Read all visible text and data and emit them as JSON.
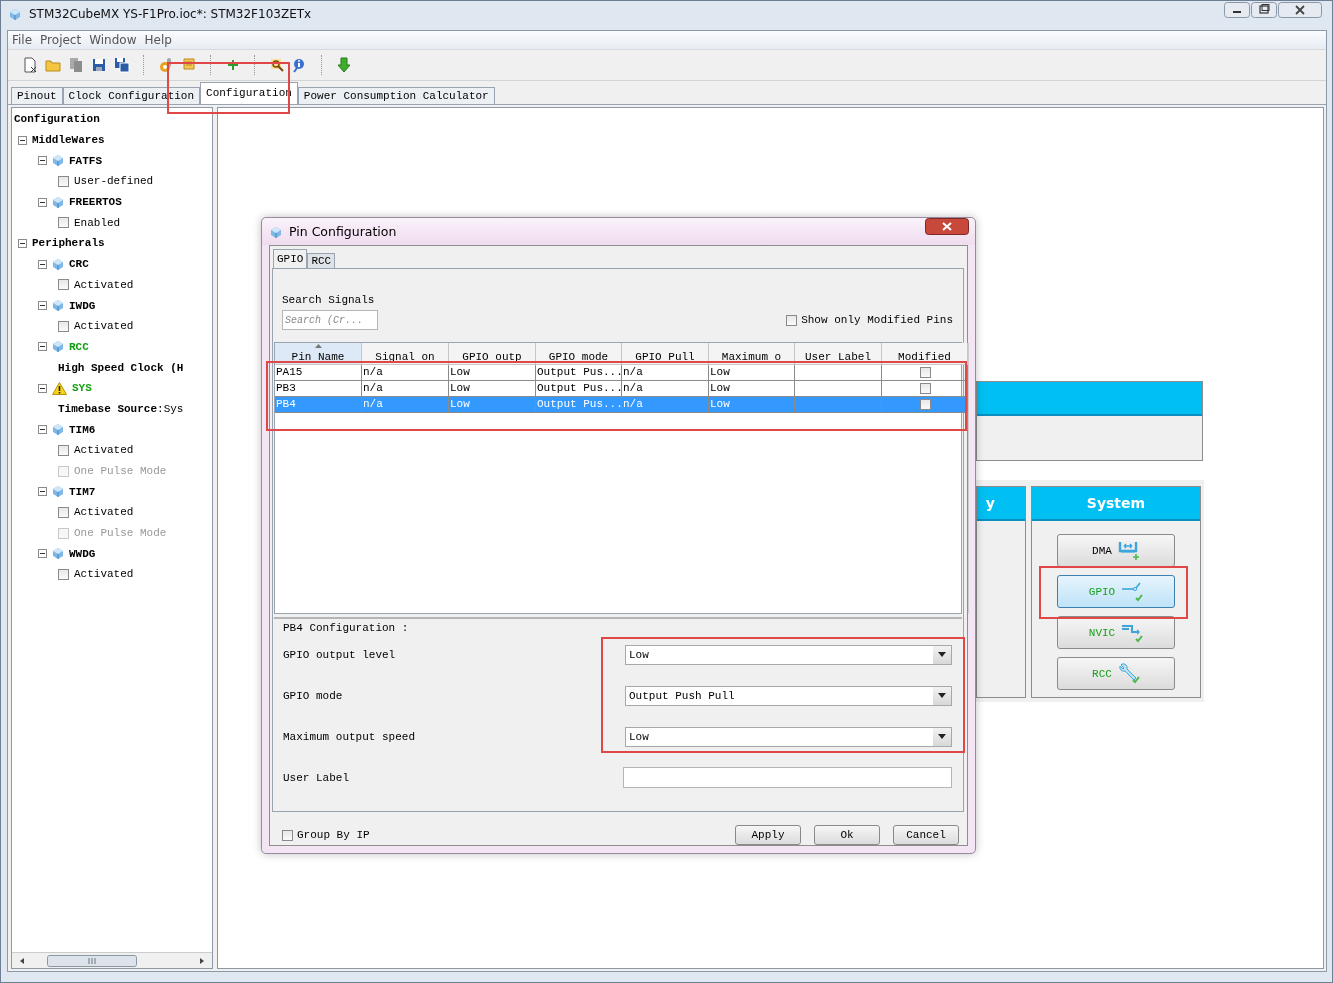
{
  "window": {
    "title": "STM32CubeMX YS-F1Pro.ioc*: STM32F103ZETx"
  },
  "menu": [
    "File",
    "Project",
    "Window",
    "Help"
  ],
  "tabs": [
    {
      "label": "Pinout",
      "selected": false
    },
    {
      "label": "Clock Configuration",
      "selected": false
    },
    {
      "label": "Configuration",
      "selected": true
    },
    {
      "label": "Power Consumption Calculator",
      "selected": false
    }
  ],
  "tree": {
    "label": "Configuration",
    "children": [
      {
        "label": "MiddleWares",
        "kind": "group",
        "children": [
          {
            "label": "FATFS",
            "kind": "ip",
            "configured": false,
            "warning": false,
            "children": [
              {
                "kind": "checkbox",
                "label": "User-defined",
                "checked": false,
                "disabled": false
              }
            ]
          },
          {
            "label": "FREERTOS",
            "kind": "ip",
            "configured": false,
            "warning": false,
            "children": [
              {
                "kind": "checkbox",
                "label": "Enabled",
                "checked": false,
                "disabled": false
              }
            ]
          }
        ]
      },
      {
        "label": "Peripherals",
        "kind": "group",
        "children": [
          {
            "label": "CRC",
            "kind": "ip",
            "configured": false,
            "warning": false,
            "children": [
              {
                "kind": "checkbox",
                "label": "Activated",
                "checked": false,
                "disabled": false
              }
            ]
          },
          {
            "label": "IWDG",
            "kind": "ip",
            "configured": false,
            "warning": false,
            "children": [
              {
                "kind": "checkbox",
                "label": "Activated",
                "checked": false,
                "disabled": false
              }
            ]
          },
          {
            "label": "RCC",
            "kind": "ip",
            "configured": true,
            "warning": false,
            "children": [
              {
                "kind": "param",
                "label": "**High Speed Clock (H**"
              }
            ]
          },
          {
            "label": "SYS",
            "kind": "ip",
            "configured": true,
            "warning": true,
            "children": [
              {
                "kind": "param",
                "label": "**Timebase Source**:Sys"
              }
            ]
          },
          {
            "label": "TIM6",
            "kind": "ip",
            "configured": false,
            "warning": false,
            "children": [
              {
                "kind": "checkbox",
                "label": "Activated",
                "checked": false,
                "disabled": false
              },
              {
                "kind": "checkbox",
                "label": "One Pulse Mode",
                "checked": false,
                "disabled": true
              }
            ]
          },
          {
            "label": "TIM7",
            "kind": "ip",
            "configured": false,
            "warning": false,
            "children": [
              {
                "kind": "checkbox",
                "label": "Activated",
                "checked": false,
                "disabled": false
              },
              {
                "kind": "checkbox",
                "label": "One Pulse Mode",
                "checked": false,
                "disabled": true
              }
            ]
          },
          {
            "label": "WWDG",
            "kind": "ip",
            "configured": false,
            "warning": false,
            "children": [
              {
                "kind": "checkbox",
                "label": "Activated",
                "checked": false,
                "disabled": false
              }
            ]
          }
        ]
      }
    ]
  },
  "category_panel": {
    "title": "y"
  },
  "system_panel": {
    "title": "System",
    "buttons": [
      {
        "label": "DMA",
        "kind": "dma",
        "configured": false,
        "selected": false
      },
      {
        "label": "GPIO",
        "kind": "gpio",
        "configured": true,
        "selected": true
      },
      {
        "label": "NVIC",
        "kind": "nvic",
        "configured": true,
        "selected": false
      },
      {
        "label": "RCC",
        "kind": "rcc",
        "configured": true,
        "selected": false
      }
    ]
  },
  "dialog": {
    "title": "Pin Configuration",
    "tabs": [
      {
        "label": "GPIO",
        "selected": true
      },
      {
        "label": "RCC",
        "selected": false
      }
    ],
    "search": {
      "label": "Search Signals",
      "placeholder": "Search (Cr..."
    },
    "show_modified": {
      "label": "Show only Modified Pins",
      "checked": false
    },
    "table": {
      "columns": [
        {
          "label": "Pin Name",
          "sorted": true
        },
        {
          "label": "Signal on",
          "sorted": false
        },
        {
          "label": "GPIO outp",
          "sorted": false
        },
        {
          "label": "GPIO mode",
          "sorted": false
        },
        {
          "label": "GPIO Pull",
          "sorted": false
        },
        {
          "label": "Maximum o",
          "sorted": false
        },
        {
          "label": "User Label",
          "sorted": false
        },
        {
          "label": "Modified",
          "sorted": false
        }
      ],
      "rows": [
        {
          "pin": "PA15",
          "signal": "n/a",
          "output": "Low",
          "mode": "Output Pus...",
          "pull": "n/a",
          "speed": "Low",
          "modified": false,
          "selected": false
        },
        {
          "pin": "PB3",
          "signal": "n/a",
          "output": "Low",
          "mode": "Output Pus...",
          "pull": "n/a",
          "speed": "Low",
          "modified": false,
          "selected": false
        },
        {
          "pin": "PB4",
          "signal": "n/a",
          "output": "Low",
          "mode": "Output Pus...",
          "pull": "n/a",
          "speed": "Low",
          "modified": false,
          "selected": true
        }
      ]
    },
    "config": {
      "title": "PB4 Configuration :",
      "fields": [
        {
          "label": "GPIO output level",
          "kind": "select",
          "value": "Low"
        },
        {
          "label": "GPIO mode",
          "kind": "select",
          "value": "Output Push Pull"
        },
        {
          "label": "Maximum output speed",
          "kind": "select",
          "value": "Low"
        },
        {
          "label": "User Label",
          "kind": "text"
        }
      ]
    },
    "group_by_ip": {
      "label": "Group By IP",
      "checked": false
    },
    "buttons": [
      "Apply",
      "Ok",
      "Cancel"
    ]
  }
}
